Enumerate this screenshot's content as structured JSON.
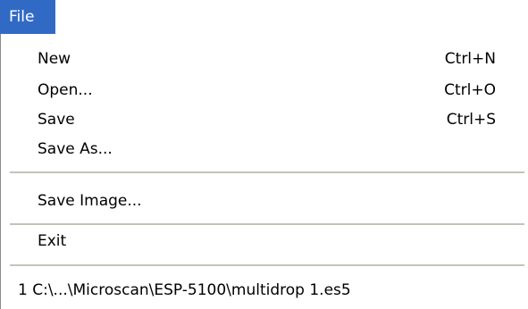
{
  "menu": {
    "title": "File",
    "items": [
      {
        "label": "New",
        "shortcut": "Ctrl+N"
      },
      {
        "label": "Open...",
        "shortcut": "Ctrl+O"
      },
      {
        "label": "Save",
        "shortcut": "Ctrl+S"
      },
      {
        "label": "Save As...",
        "shortcut": ""
      },
      {
        "label": "Save Image...",
        "shortcut": ""
      },
      {
        "label": "Exit",
        "shortcut": ""
      }
    ],
    "recent_files": [
      {
        "label": "1 C:\\...\\Microscan\\ESP-5100\\multidrop 1.es5"
      }
    ]
  },
  "colors": {
    "menu_highlight": "#316ac5",
    "separator": "#c5c2b8"
  }
}
